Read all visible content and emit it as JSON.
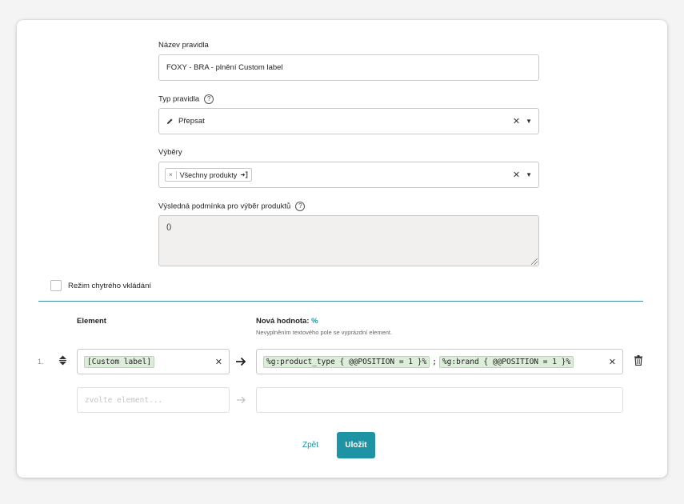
{
  "form": {
    "rule_name_label": "Název pravidla",
    "rule_name_value": "FOXY - BRA - plnění Custom label",
    "rule_type_label": "Typ pravidla",
    "rule_type_value": "Přepsat",
    "selections_label": "Výběry",
    "selection_chip": "Všechny produkty",
    "condition_label": "Výsledná podmínka pro výběr produktů",
    "condition_value": "()",
    "help_glyph": "?",
    "clear_glyph": "✕",
    "caret_glyph": "▼",
    "chip_remove_glyph": "×"
  },
  "smart_insert": {
    "label": "Režim chytrého vkládání",
    "checked": false
  },
  "table": {
    "element_header": "Element",
    "value_header": "Nová hodnota:",
    "value_header_suffix": "%",
    "value_hint": "Nevyplněním textového pole se vyprázdní element.",
    "rows": [
      {
        "index": "1.",
        "element": "[Custom label]",
        "value_tokens": [
          "%g:product_type { @@POSITION = 1 }%",
          "%g:brand { @@POSITION = 1 }%"
        ],
        "value_separator": ";"
      }
    ],
    "new_row_placeholder": "zvolte element..."
  },
  "actions": {
    "back_label": "Zpět",
    "save_label": "Uložit"
  },
  "colors": {
    "accent": "#1e93a4",
    "divider": "#3d8fa3",
    "token_bg": "#dcedd9",
    "textarea_bg": "#f1f0ee"
  }
}
